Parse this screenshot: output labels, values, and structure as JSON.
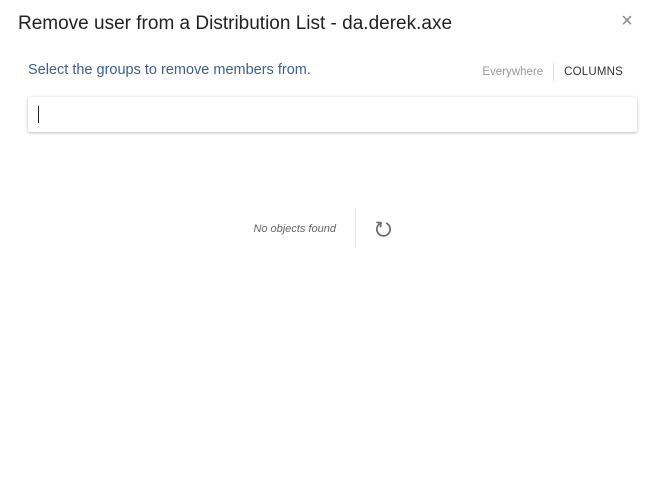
{
  "dialog": {
    "title": "Remove user from a Distribution List - da.derek.axe",
    "close_icon": "close-icon",
    "close_glyph": "×"
  },
  "header": {
    "instruction": "Select the groups to remove members from.",
    "scope_label": "Everywhere",
    "columns_label": "COLUMNS"
  },
  "search": {
    "value": "",
    "placeholder": ""
  },
  "results": {
    "empty_message": "No objects found",
    "refresh_icon": "refresh-icon"
  },
  "colors": {
    "instruction_text": "#3a5f95",
    "title_text": "#222222",
    "muted_text": "#9a9a9a",
    "background": "#ffffff"
  }
}
